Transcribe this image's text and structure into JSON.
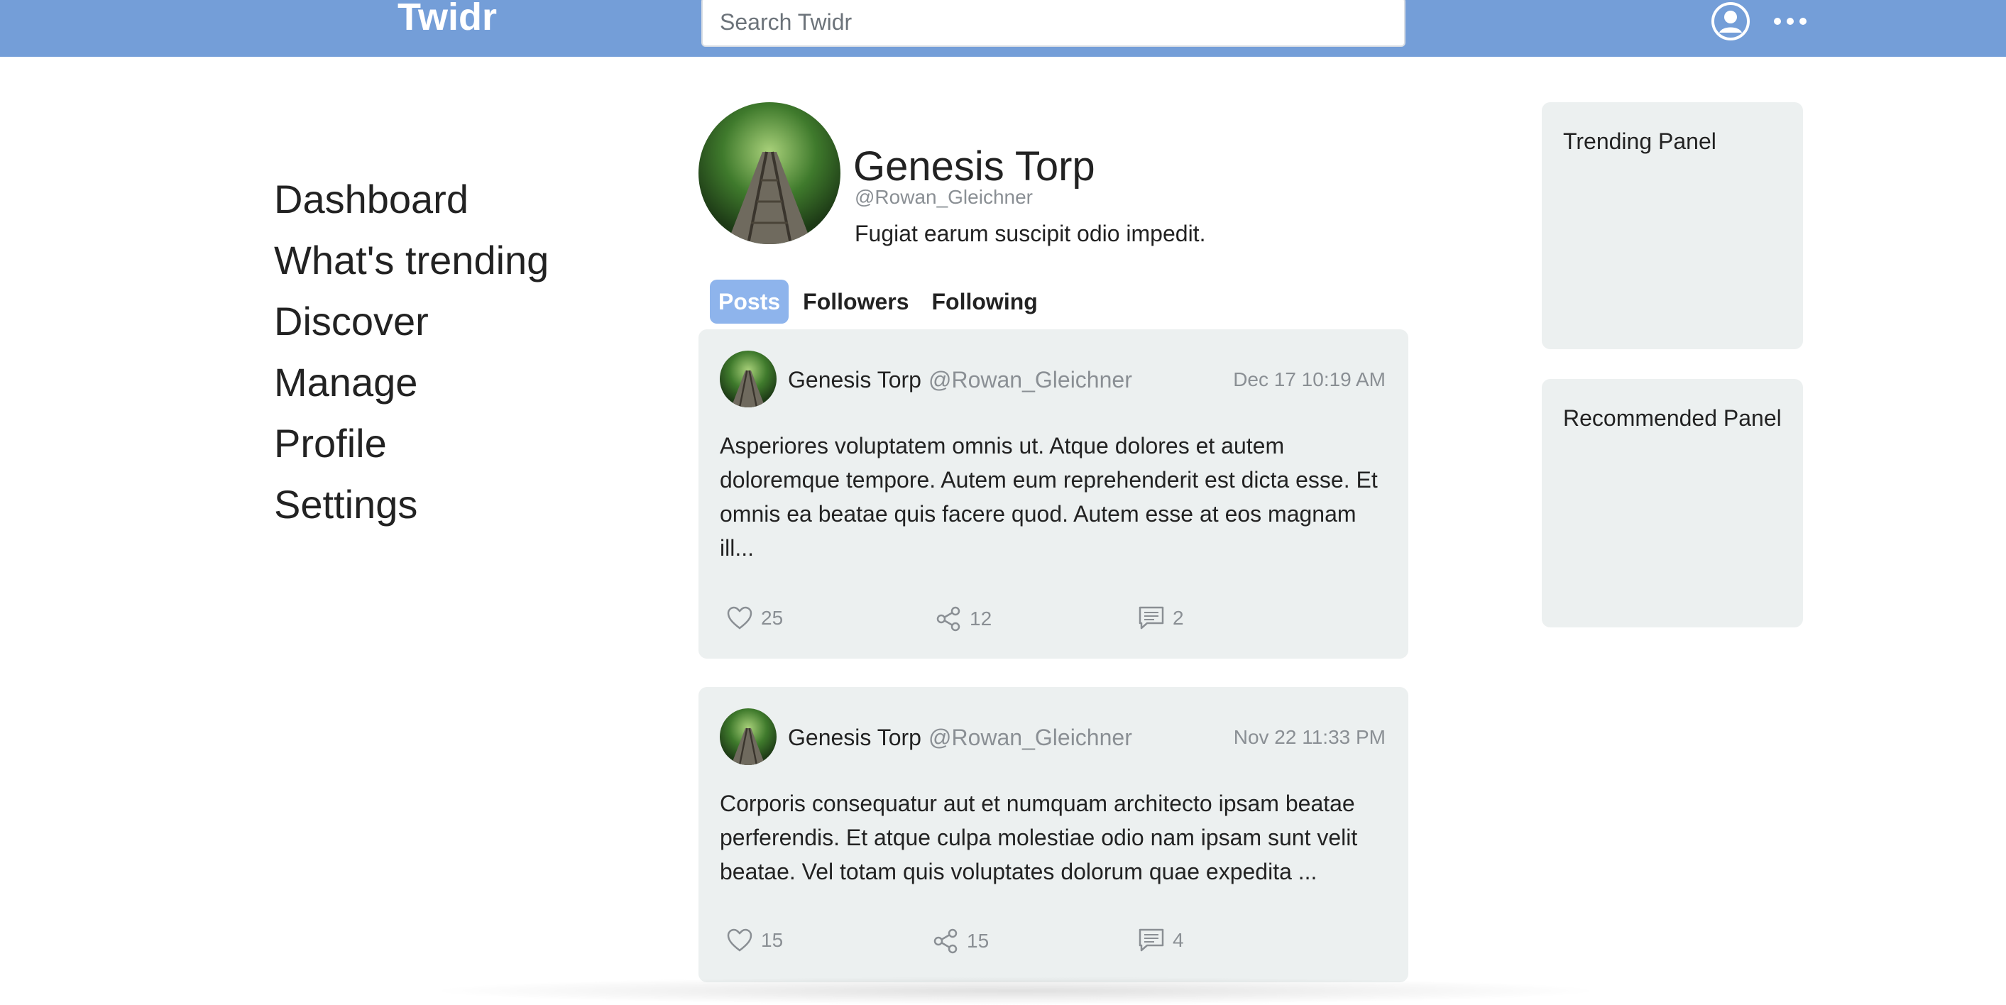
{
  "app": {
    "brand": "Twidr",
    "search_placeholder": "Search Twidr"
  },
  "nav": {
    "items": [
      "Dashboard",
      "What's trending",
      "Discover",
      "Manage",
      "Profile",
      "Settings"
    ]
  },
  "profile": {
    "name": "Genesis Torp",
    "handle": "@Rowan_Gleichner",
    "bio": "Fugiat earum suscipit odio impedit."
  },
  "tabs": [
    "Posts",
    "Followers",
    "Following"
  ],
  "active_tab": "Posts",
  "posts": [
    {
      "author": "Genesis Torp",
      "handle": "@Rowan_Gleichner",
      "time": "Dec 17 10:19 AM",
      "body": "Asperiores voluptatem omnis ut. Atque dolores et autem doloremque tempore. Autem eum reprehenderit est dicta esse. Et omnis ea beatae quis facere quod. Autem esse at eos magnam ill...",
      "likes": "25",
      "shares": "12",
      "comments": "2"
    },
    {
      "author": "Genesis Torp",
      "handle": "@Rowan_Gleichner",
      "time": "Nov 22 11:33 PM",
      "body": "Corporis consequatur aut et numquam architecto ipsam beatae perferendis. Et atque culpa molestiae odio nam ipsam sunt velit beatae. Vel totam quis voluptates dolorum quae expedita ...",
      "likes": "15",
      "shares": "15",
      "comments": "4"
    }
  ],
  "panels": {
    "trending": "Trending Panel",
    "recommended": "Recommended Panel"
  },
  "icons": {
    "user": "user-circle-icon",
    "more": "more-horizontal-icon",
    "like": "heart-icon",
    "share": "share-icon",
    "comment": "comment-icon"
  },
  "colors": {
    "topbar": "#749ed8",
    "active_tab": "#8eb4ec",
    "card_bg": "#ecf0f0",
    "muted_text": "#8a8f94"
  }
}
